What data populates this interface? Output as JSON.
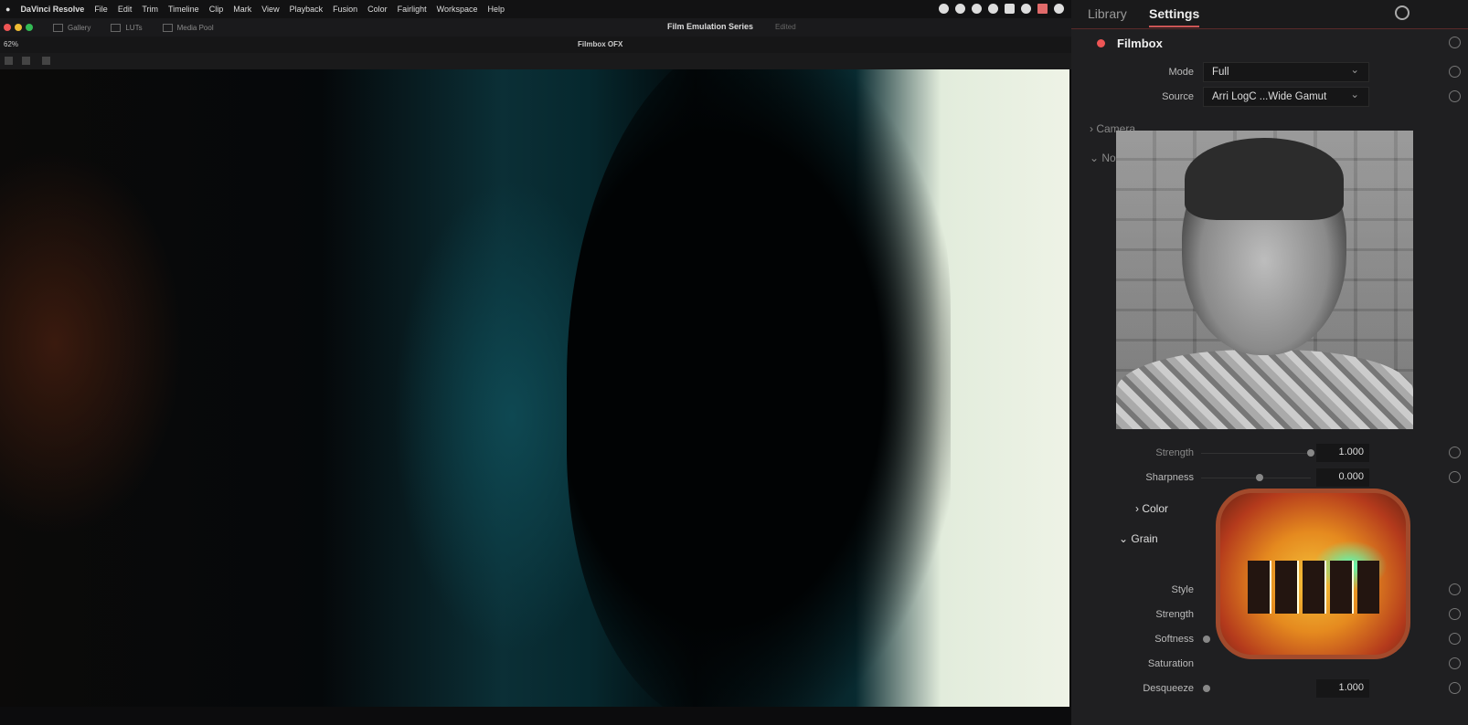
{
  "menubar": {
    "app": "DaVinci Resolve",
    "items": [
      "File",
      "Edit",
      "Trim",
      "Timeline",
      "Clip",
      "Mark",
      "View",
      "Playback",
      "Fusion",
      "Color",
      "Fairlight",
      "Workspace",
      "Help"
    ]
  },
  "toolbar": {
    "gallery": "Gallery",
    "luts": "LUTs",
    "media_pool": "Media Pool",
    "project": "Film Emulation Series",
    "project_status": "Edited"
  },
  "viewer": {
    "zoom": "62%",
    "clip": "Filmbox OFX"
  },
  "panel": {
    "tabs": [
      {
        "label": "Library"
      },
      {
        "label": "Settings",
        "active": true
      }
    ],
    "plugin": "Filmbox",
    "mode": {
      "label": "Mode",
      "value": "Full"
    },
    "source": {
      "label": "Source",
      "value": "Arri LogC ...Wide Gamut"
    },
    "sections": {
      "camera": "Camera",
      "color": "Color",
      "grain": "Grain",
      "partial": "No"
    },
    "params": [
      {
        "label": "Strength",
        "value": "1.000",
        "level": 1.0
      },
      {
        "label": "Sharpness",
        "value": "0.000",
        "level": 0.5
      }
    ],
    "grain": [
      {
        "label": "Style"
      },
      {
        "label": "Strength"
      },
      {
        "label": "Softness"
      },
      {
        "label": "Saturation"
      },
      {
        "label": "Desqueeze",
        "value": "1.000"
      }
    ]
  },
  "colors": {
    "accent": "#e55555",
    "panel": "#1f1f21"
  }
}
